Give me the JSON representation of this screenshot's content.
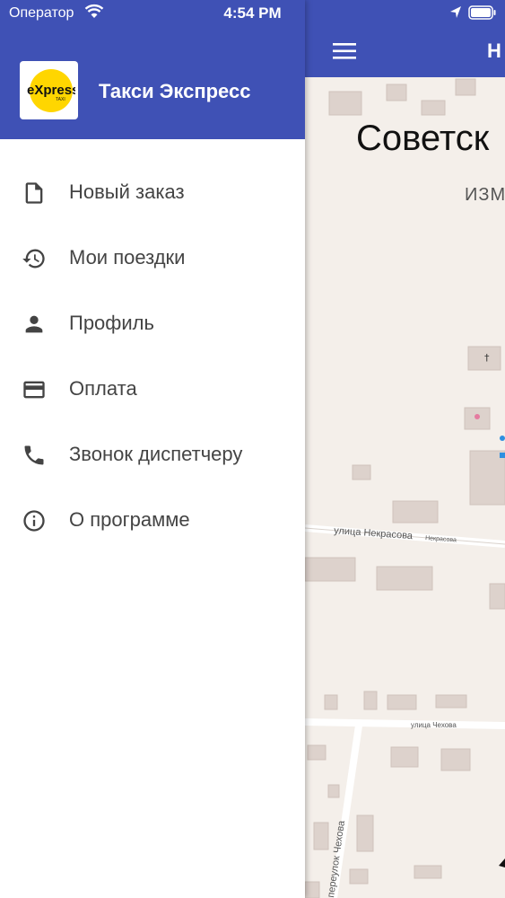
{
  "status_bar": {
    "carrier": "Оператор",
    "time": "4:54 PM"
  },
  "app_bar": {
    "title": "Н"
  },
  "map": {
    "city_label": "Советск",
    "district_label": "ИЗМ",
    "streets": [
      "улица Некрасова",
      "Некрасова",
      "улица Чехова",
      "переулок Чехова"
    ],
    "poi_church": "Церковь"
  },
  "drawer": {
    "title": "Такси Экспресс",
    "logo_text": "eXpress",
    "logo_subtext": "TAXI",
    "items": [
      {
        "label": "Новый заказ",
        "icon": "document-icon"
      },
      {
        "label": "Мои поездки",
        "icon": "history-icon"
      },
      {
        "label": "Профиль",
        "icon": "person-icon"
      },
      {
        "label": "Оплата",
        "icon": "credit-card-icon"
      },
      {
        "label": "Звонок диспетчеру",
        "icon": "phone-icon"
      },
      {
        "label": "О программе",
        "icon": "info-icon"
      }
    ]
  },
  "colors": {
    "primary": "#3f51b5",
    "logo_yellow": "#ffd600",
    "map_background": "#f4efea",
    "building": "#ddd2cc"
  }
}
